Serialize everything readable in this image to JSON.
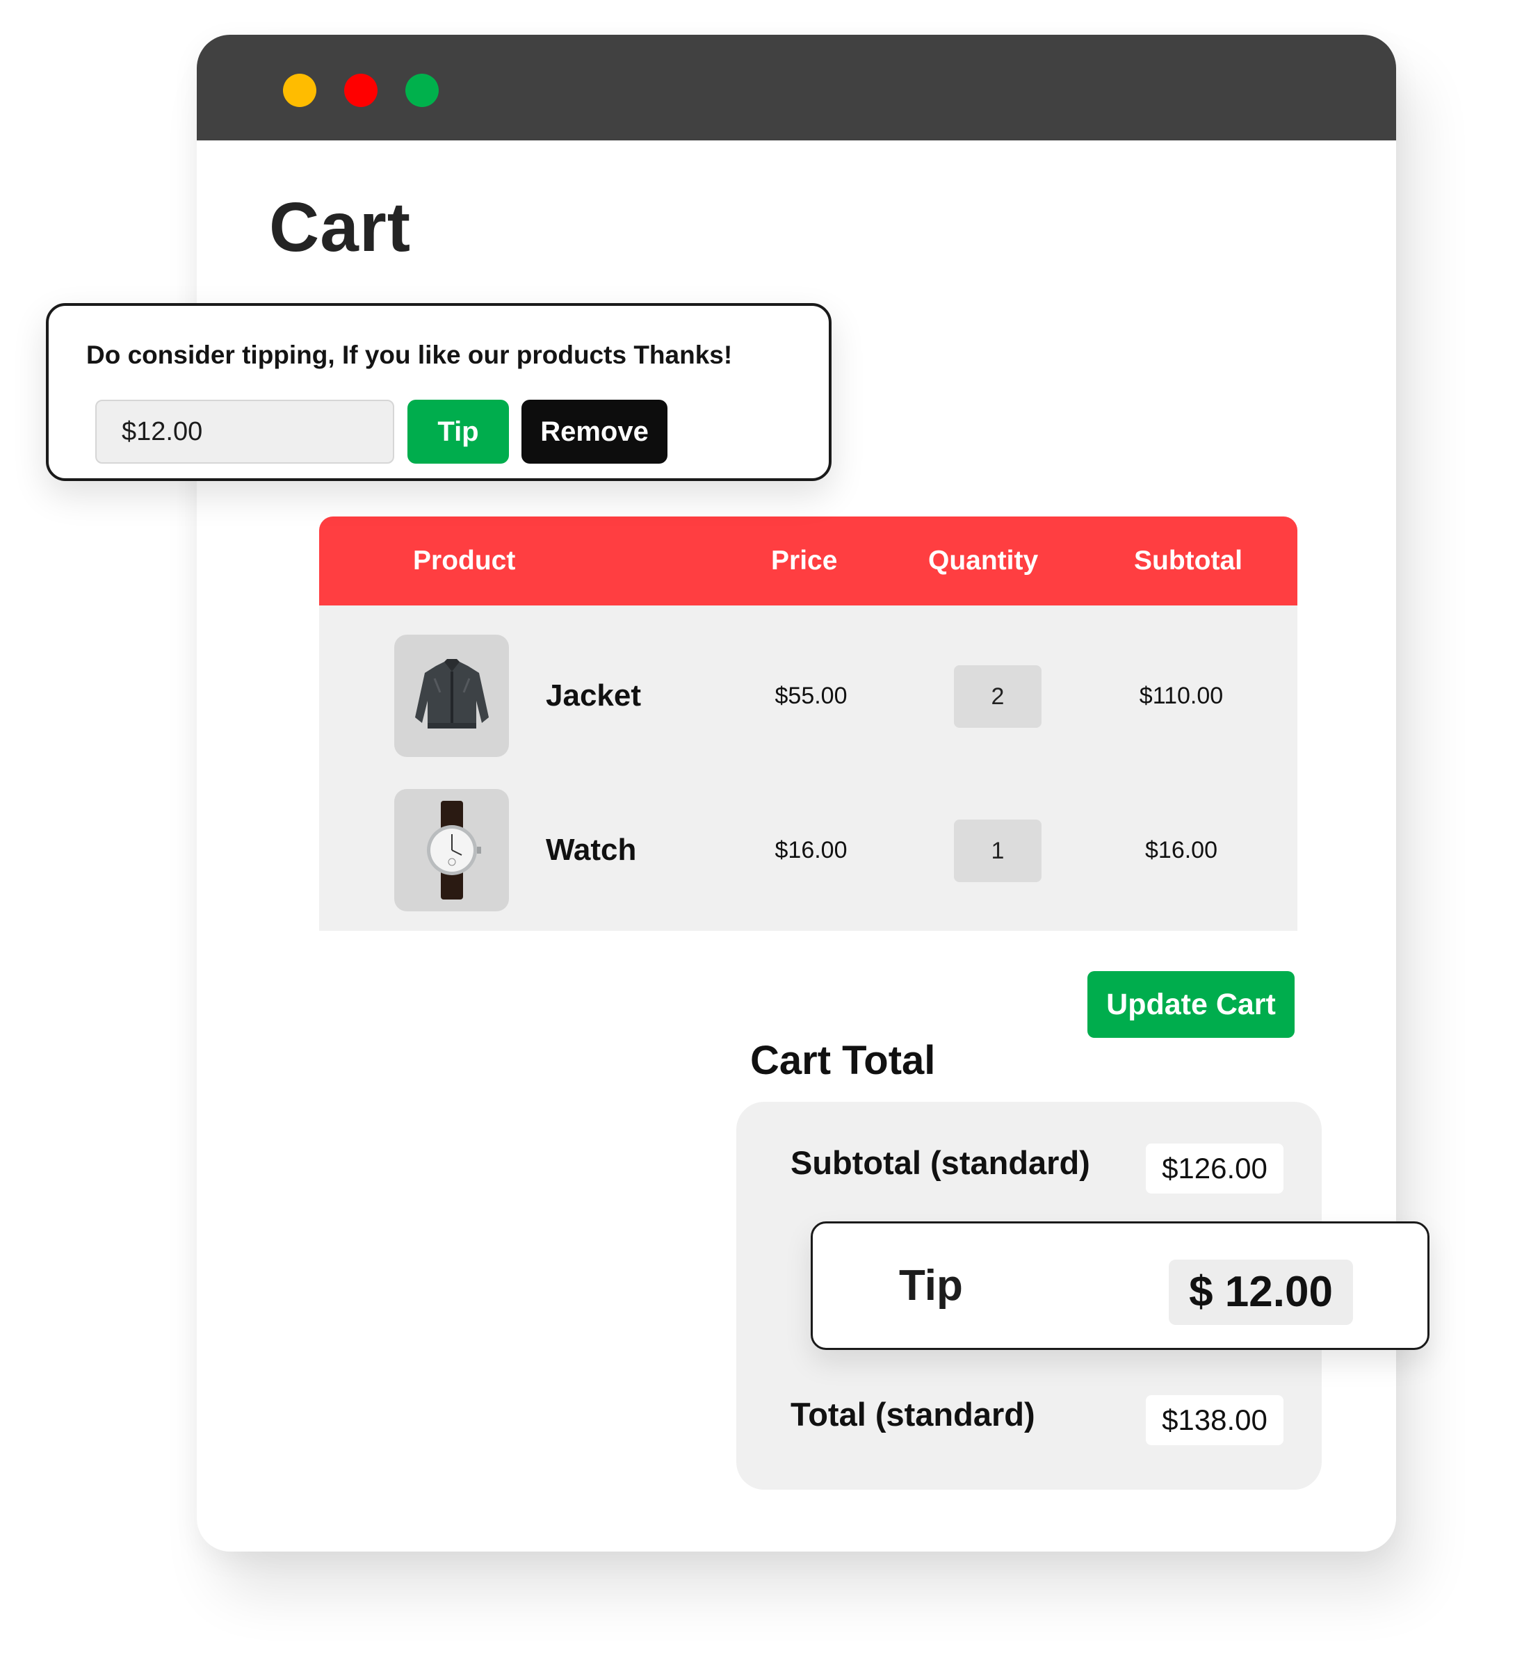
{
  "window": {
    "dots": [
      {
        "name": "minimize",
        "color": "#ffbc00"
      },
      {
        "name": "close",
        "color": "#ff0000"
      },
      {
        "name": "maximize",
        "color": "#00b14c"
      }
    ]
  },
  "page": {
    "title": "Cart"
  },
  "tip_prompt": {
    "message": "Do consider tipping, If you like our products Thanks!",
    "amount_value": "$12.00",
    "tip_label": "Tip",
    "remove_label": "Remove"
  },
  "table": {
    "headers": {
      "product": "Product",
      "price": "Price",
      "quantity": "Quantity",
      "subtotal": "Subtotal"
    },
    "rows": [
      {
        "icon": "jacket-image",
        "name": "Jacket",
        "price": "$55.00",
        "quantity": "2",
        "subtotal": "$110.00"
      },
      {
        "icon": "watch-image",
        "name": "Watch",
        "price": "$16.00",
        "quantity": "1",
        "subtotal": "$16.00"
      }
    ]
  },
  "update_cart_label": "Update Cart",
  "totals": {
    "title": "Cart Total",
    "subtotal_label": "Subtotal (standard)",
    "subtotal_value": "$126.00",
    "tip_label": "Tip",
    "tip_value": "$ 12.00",
    "total_label": "Total (standard)",
    "total_value": "$138.00"
  },
  "colors": {
    "accent_red": "#ff3e41",
    "accent_green": "#00ad4d",
    "titlebar": "#414141"
  }
}
